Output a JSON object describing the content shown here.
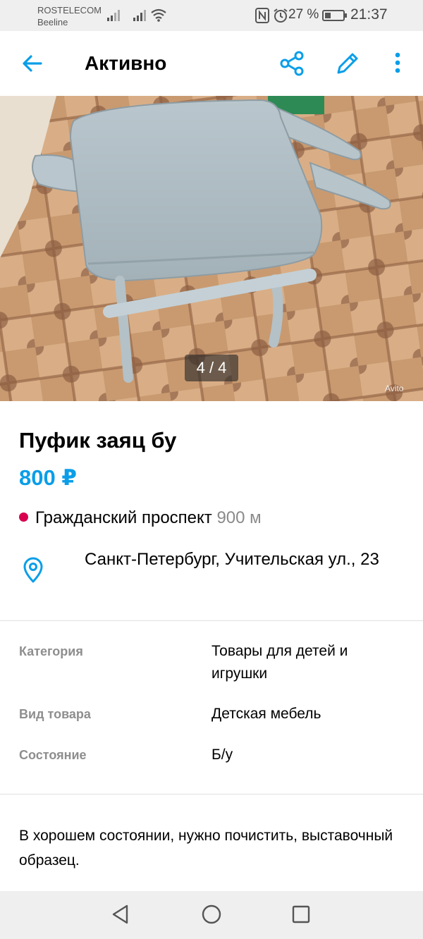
{
  "status_bar": {
    "carrier1": "ROSTELECOM",
    "carrier2": "Beeline",
    "battery_percent": "27 %",
    "time": "21:37"
  },
  "app_bar": {
    "title": "Активно"
  },
  "gallery": {
    "counter": "4 / 4",
    "watermark": "Avito"
  },
  "listing": {
    "title": "Пуфик заяц бу",
    "price": "800 ₽",
    "metro_station": "Гражданский проспект",
    "metro_distance": "900 м",
    "metro_color": "#d8004f",
    "address": "Санкт-Петербург, Учительская ул., 23"
  },
  "params": [
    {
      "label": "Категория",
      "value": "Товары для детей и игрушки"
    },
    {
      "label": "Вид товара",
      "value": "Детская мебель"
    },
    {
      "label": "Состояние",
      "value": "Б/у"
    }
  ],
  "description": "В хорошем состоянии, нужно почистить, выставочный образец.",
  "colors": {
    "accent": "#0a9ee8",
    "metro": "#d8004f"
  }
}
